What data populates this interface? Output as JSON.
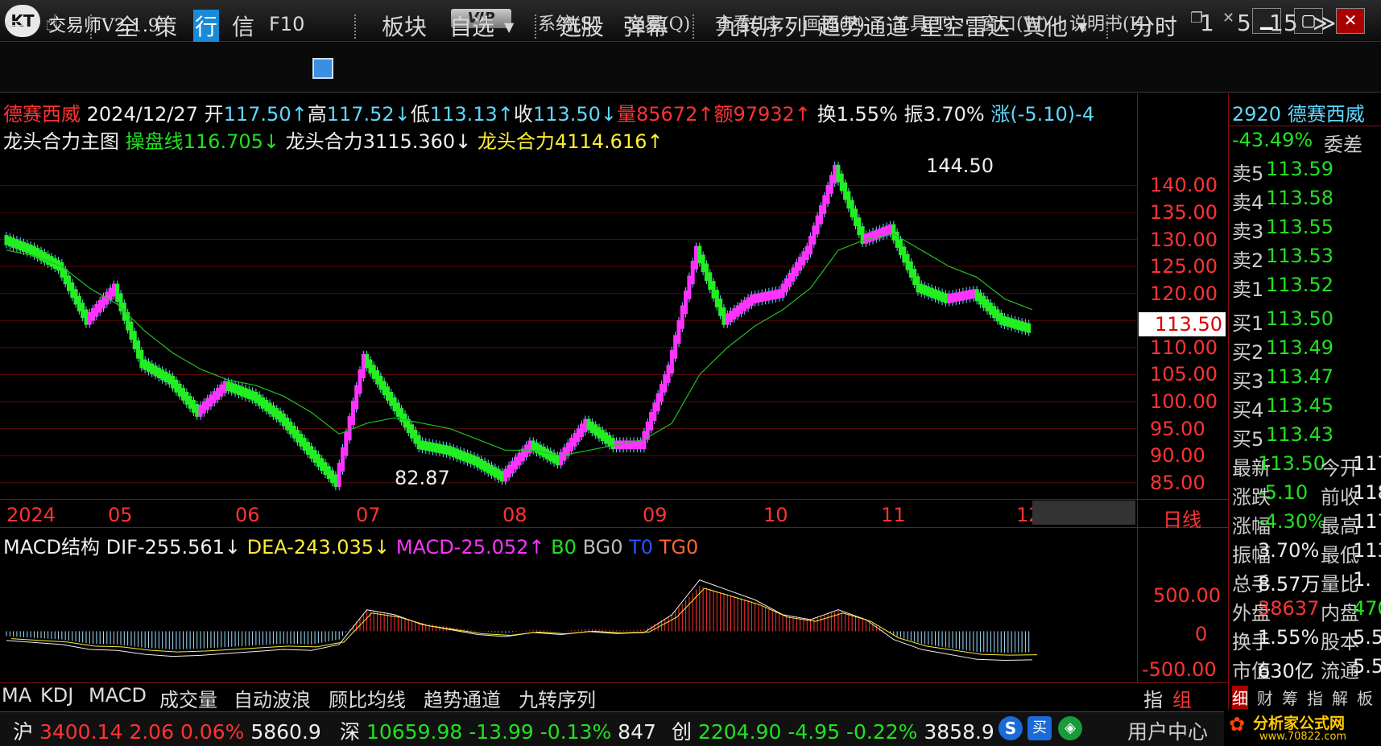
{
  "window": {
    "title": "交易师V2.1.9",
    "logo": "KT",
    "vip": "VIP",
    "menus": [
      "系统(S)",
      "交易(Q)",
      "查看(L)",
      "画面(P)",
      "工具(T)",
      "窗口(W)",
      "说明书(H)"
    ]
  },
  "toolbar": {
    "items": [
      "全",
      "策",
      "行",
      "信",
      "F10",
      "板块",
      "自选",
      "选股",
      "弹幕",
      "九转序列",
      "趋势通道",
      "星空雷达",
      "其他",
      "分时",
      "1",
      "5",
      "15"
    ]
  },
  "stock_info": {
    "name": "德赛西威",
    "date": "2024/12/27",
    "open_label": "开",
    "open": "117.50",
    "high_label": "高",
    "high": "117.52",
    "low_label": "低",
    "low": "113.13",
    "close_label": "收",
    "close": "113.50",
    "vol_label": "量",
    "vol": "85672",
    "amt_label": "额",
    "amt": "97932",
    "turn_label": "换",
    "turn": "1.55%",
    "amp_label": "振",
    "amp": "3.70%",
    "chg_label": "涨",
    "chg": "(-5.10)-4"
  },
  "indicator_line": {
    "name": "龙头合力主图",
    "l1_label": "操盘线",
    "l1": "116.705",
    "l2_label": "龙头合力3",
    "l2": "115.360",
    "l3_label": "龙头合力4",
    "l3": "114.616"
  },
  "price_axis": [
    "140.00",
    "135.00",
    "130.00",
    "125.00",
    "120.00",
    "115.00",
    "110.00",
    "105.00",
    "100.00",
    "95.00",
    "90.00",
    "85.00"
  ],
  "current_price": "113.50",
  "annotations": {
    "high": "144.50",
    "low": "82.87"
  },
  "months": [
    "2024",
    "05",
    "06",
    "07",
    "08",
    "09",
    "10",
    "11",
    "12"
  ],
  "period": "日线",
  "macd_line": {
    "name": "MACD结构",
    "dif_label": "DIF",
    "dif": "-255.561",
    "dea_label": "DEA",
    "dea": "-243.035",
    "macd_label": "MACD",
    "macd": "-25.052",
    "b": "B",
    "b_v": "0",
    "bg": "BG",
    "bg_v": "0",
    "t": "T",
    "t_v": "0",
    "tg": "TG",
    "tg_v": "0"
  },
  "macd_axis": [
    "500.00",
    "0",
    "-500.00"
  ],
  "right_panel": {
    "code_name": "2920 德赛西威",
    "weibi": "-43.49%",
    "weicha": "委差",
    "sells": [
      [
        "卖5",
        "113.59"
      ],
      [
        "卖4",
        "113.58"
      ],
      [
        "卖3",
        "113.55"
      ],
      [
        "卖2",
        "113.53"
      ],
      [
        "卖1",
        "113.52"
      ]
    ],
    "buys": [
      [
        "买1",
        "113.50"
      ],
      [
        "买2",
        "113.49"
      ],
      [
        "买3",
        "113.47"
      ],
      [
        "买4",
        "113.45"
      ],
      [
        "买5",
        "113.43"
      ]
    ],
    "stats": [
      [
        "最新",
        "113.50",
        "今开",
        "117."
      ],
      [
        "涨跌",
        "-5.10",
        "前收",
        "118."
      ],
      [
        "涨幅",
        "-4.30%",
        "最高",
        "117."
      ],
      [
        "振幅",
        "3.70%",
        "最低",
        "113."
      ],
      [
        "总手",
        "8.57万",
        "量比",
        "1."
      ],
      [
        "外盘",
        "38637",
        "内盘",
        "470"
      ],
      [
        "换手",
        "1.55%",
        "股本",
        "5.55"
      ],
      [
        "市值",
        "630亿",
        "流通",
        "5.52"
      ]
    ],
    "tabs": [
      "细",
      "财",
      "筹",
      "指",
      "解",
      "板"
    ]
  },
  "indicators": [
    "MA",
    "KDJ",
    "MACD",
    "成交量",
    "自动波浪",
    "顾比均线",
    "趋势通道",
    "九转序列"
  ],
  "ind_right": [
    "指",
    "组"
  ],
  "status": {
    "sh_label": "沪",
    "sh": "3400.14",
    "sh_c": "2.06",
    "sh_p": "0.06%",
    "sh_v": "5860.9",
    "sz_label": "深",
    "sz": "10659.98",
    "sz_c": "-13.99",
    "sz_p": "-0.13%",
    "sz_v": "847",
    "cy_label": "创",
    "cy": "2204.90",
    "cy_c": "-4.95",
    "cy_p": "-0.22%",
    "cy_v": "3858.9",
    "user": "用户中心",
    "buy_icon": "买",
    "watermark": "分析家公式网",
    "watermark_url": "www.70822.com"
  },
  "chart_data": {
    "type": "candlestick",
    "ylim": [
      82,
      146
    ],
    "x": [
      "2024-04-10",
      "2024-04-17",
      "2024-04-24",
      "2024-05-01",
      "2024-05-08",
      "2024-05-15",
      "2024-05-22",
      "2024-05-29",
      "2024-06-05",
      "2024-06-12",
      "2024-06-19",
      "2024-06-26",
      "2024-07-03",
      "2024-07-10",
      "2024-07-17",
      "2024-07-24",
      "2024-07-31",
      "2024-08-07",
      "2024-08-14",
      "2024-08-21",
      "2024-08-28",
      "2024-09-04",
      "2024-09-11",
      "2024-09-18",
      "2024-09-25",
      "2024-10-02",
      "2024-10-09",
      "2024-10-16",
      "2024-10-23",
      "2024-10-30",
      "2024-11-06",
      "2024-11-13",
      "2024-11-20",
      "2024-11-27",
      "2024-12-04",
      "2024-12-11",
      "2024-12-18",
      "2024-12-27"
    ],
    "close": [
      130,
      128,
      125,
      115,
      121,
      107,
      104,
      98,
      103,
      101,
      97,
      91,
      85,
      108,
      100,
      92,
      91,
      89,
      86,
      92,
      89,
      96,
      92,
      92,
      106,
      128,
      115,
      119,
      120,
      128,
      143,
      130,
      132,
      121,
      119,
      120,
      115,
      113.5
    ],
    "ma": [
      128,
      127,
      125,
      121,
      118,
      113,
      109,
      106,
      104,
      103,
      101,
      98,
      94,
      96,
      97,
      96,
      95,
      93,
      91,
      91,
      90,
      91,
      92,
      93,
      96,
      105,
      110,
      114,
      117,
      121,
      128,
      130,
      131,
      128,
      125,
      123,
      119,
      117
    ],
    "macd_hist": [
      -60,
      -80,
      -100,
      -150,
      -160,
      -200,
      -220,
      -210,
      -190,
      -170,
      -150,
      -160,
      -100,
      250,
      200,
      100,
      50,
      0,
      -20,
      20,
      0,
      30,
      10,
      20,
      200,
      550,
      450,
      350,
      200,
      150,
      250,
      150,
      -50,
      -150,
      -200,
      -250,
      -260,
      -255
    ],
    "macd_ylim": [
      -600,
      900
    ]
  }
}
